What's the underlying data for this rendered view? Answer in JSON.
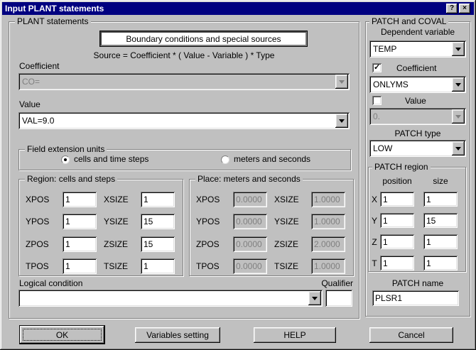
{
  "window": {
    "title": "Input PLANT statements",
    "help_glyph": "?",
    "close_glyph": "×"
  },
  "plant": {
    "group_label": "PLANT statements",
    "header_button": "Boundary conditions and special sources",
    "formula": "Source = Coefficient * ( Value - Variable ) * Type",
    "coefficient": {
      "label": "Coefficient",
      "value": "CO="
    },
    "value": {
      "label": "Value",
      "value": "VAL=9.0"
    },
    "field_extension": {
      "group_label": "Field extension units",
      "options": [
        {
          "label": "cells and time steps",
          "selected": true
        },
        {
          "label": "meters and seconds",
          "selected": false
        }
      ]
    },
    "region": {
      "group_label": "Region: cells and steps",
      "rows": [
        {
          "pos_label": "XPOS",
          "pos_value": "1",
          "size_label": "XSIZE",
          "size_value": "1"
        },
        {
          "pos_label": "YPOS",
          "pos_value": "1",
          "size_label": "YSIZE",
          "size_value": "15"
        },
        {
          "pos_label": "ZPOS",
          "pos_value": "1",
          "size_label": "ZSIZE",
          "size_value": "15"
        },
        {
          "pos_label": "TPOS",
          "pos_value": "1",
          "size_label": "TSIZE",
          "size_value": "1"
        }
      ]
    },
    "place": {
      "group_label": "Place: meters and seconds",
      "rows": [
        {
          "pos_label": "XPOS",
          "pos_value": "0.0000",
          "size_label": "XSIZE",
          "size_value": "1.0000"
        },
        {
          "pos_label": "YPOS",
          "pos_value": "0.0000",
          "size_label": "YSIZE",
          "size_value": "1.0000"
        },
        {
          "pos_label": "ZPOS",
          "pos_value": "0.0000",
          "size_label": "ZSIZE",
          "size_value": "2.0000"
        },
        {
          "pos_label": "TPOS",
          "pos_value": "0.0000",
          "size_label": "TSIZE",
          "size_value": "1.0000"
        }
      ]
    },
    "logical_condition": {
      "label": "Logical condition",
      "value": ""
    },
    "qualifier": {
      "label": "Qualifier",
      "value": ""
    }
  },
  "patch": {
    "group_label": "PATCH and COVAL",
    "dependent_variable": {
      "label": "Dependent variable",
      "value": "TEMP"
    },
    "coefficient_checkbox": {
      "label": "Coefficient",
      "checked": true,
      "value": "ONLYMS"
    },
    "value_checkbox": {
      "label": "Value",
      "checked": false,
      "value": "0."
    },
    "patch_type": {
      "label": "PATCH type",
      "value": "LOW"
    },
    "region": {
      "group_label": "PATCH region",
      "col_position": "position",
      "col_size": "size",
      "rows": [
        {
          "axis": "X",
          "position": "1",
          "size": "1"
        },
        {
          "axis": "Y",
          "position": "1",
          "size": "15"
        },
        {
          "axis": "Z",
          "position": "1",
          "size": "1"
        },
        {
          "axis": "T",
          "position": "1",
          "size": "1"
        }
      ]
    },
    "patch_name": {
      "label": "PATCH name",
      "value": "PLSR1"
    }
  },
  "buttons": {
    "ok": "OK",
    "variables": "Variables setting",
    "help": "HELP",
    "cancel": "Cancel"
  },
  "colors": {
    "titlebar": "#000080",
    "face": "#c0c0c0",
    "shadow": "#808080",
    "highlight": "#ffffff",
    "field": "#ffffff",
    "disabled_text": "#808080"
  }
}
